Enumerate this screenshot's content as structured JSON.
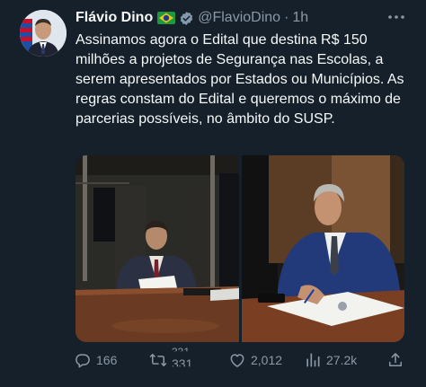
{
  "tweet": {
    "author_name": "Flávio Dino",
    "handle": "@FlavioDino",
    "separator": "·",
    "time": "1h",
    "text": "Assinamos agora o Edital que destina R$ 150 milhões a projetos de Segurança nas Escolas, a serem apresentados por Estados ou Municípios. As regras constam do Edital e queremos o máximo de parcerias possíveis, no âmbito do SUSP.",
    "badges": [
      "brazil-flag-icon",
      "verified-gray-icon"
    ]
  },
  "media": {
    "count": 2,
    "items": [
      "photo-signing-at-desk",
      "photo-signing-document-closeup"
    ]
  },
  "actions": {
    "replies": "166",
    "retweets_previous": "331",
    "retweets": "331",
    "likes": "2,012",
    "views": "27.2k"
  },
  "colors": {
    "background": "#15202b",
    "text": "#f7f9f9",
    "muted": "#8b98a5"
  }
}
